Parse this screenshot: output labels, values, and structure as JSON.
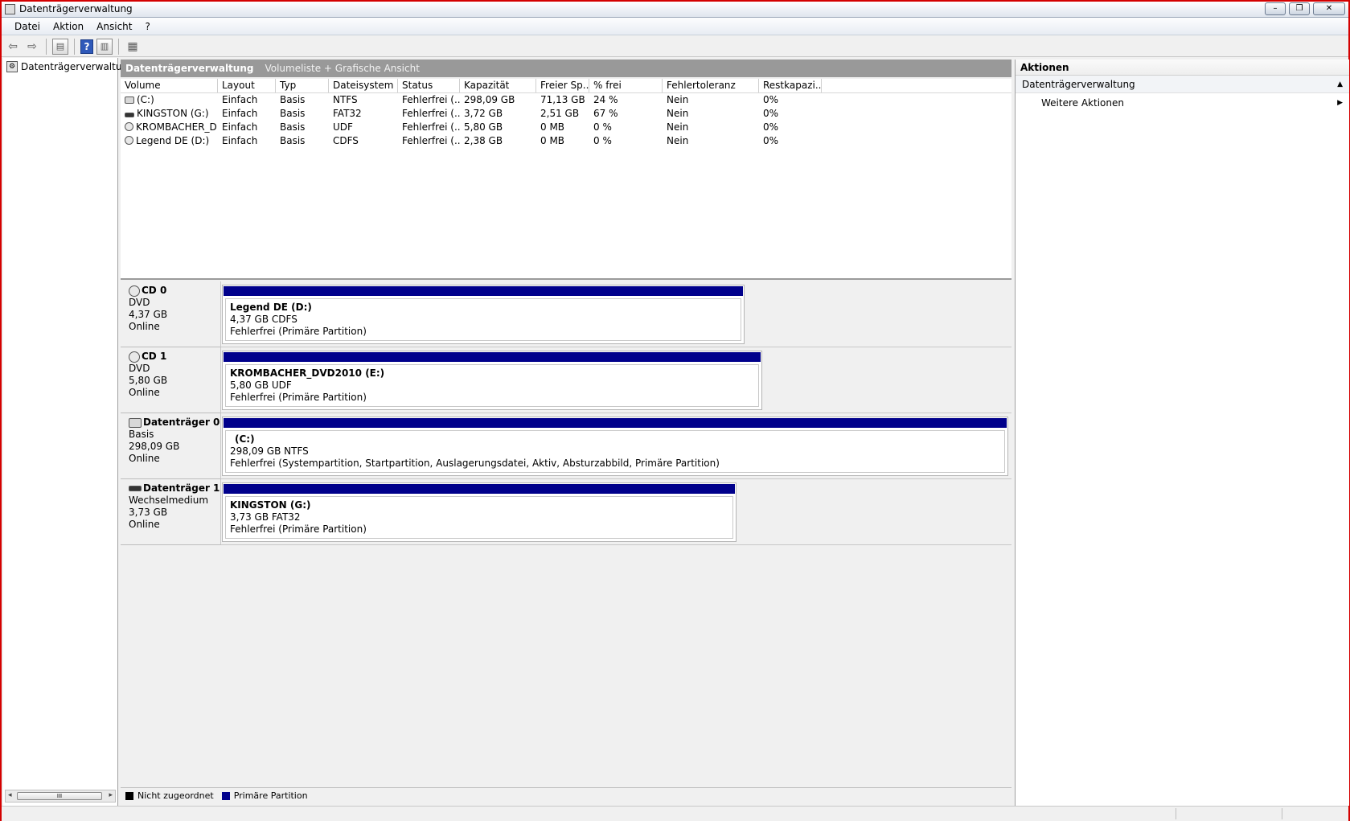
{
  "window": {
    "title": "Datenträgerverwaltung"
  },
  "window_buttons": {
    "minimize": "–",
    "restore": "❐",
    "close": "✕"
  },
  "menu": [
    "Datei",
    "Aktion",
    "Ansicht",
    "?"
  ],
  "toolbar": {
    "back": "⇦",
    "forward": "⇨",
    "help": "?"
  },
  "tree": {
    "item": "Datenträgerverwaltung",
    "scroll_thumb": "III"
  },
  "panel_header": {
    "main": "Datenträgerverwaltung",
    "sub": "Volumeliste + Grafische Ansicht"
  },
  "volume_list": {
    "columns": [
      "Volume",
      "Layout",
      "Typ",
      "Dateisystem",
      "Status",
      "Kapazität",
      "Freier Sp...",
      "% frei",
      "Fehlertoleranz",
      "Restkapazi..."
    ],
    "rows": [
      {
        "icon": "hdd",
        "cells": [
          "(C:)",
          "Einfach",
          "Basis",
          "NTFS",
          "Fehlerfrei (...",
          "298,09 GB",
          "71,13 GB",
          "24 %",
          "Nein",
          "0%"
        ]
      },
      {
        "icon": "usb",
        "cells": [
          "KINGSTON (G:)",
          "Einfach",
          "Basis",
          "FAT32",
          "Fehlerfrei (...",
          "3,72 GB",
          "2,51 GB",
          "67 %",
          "Nein",
          "0%"
        ]
      },
      {
        "icon": "cd",
        "cells": [
          "KROMBACHER_D...",
          "Einfach",
          "Basis",
          "UDF",
          "Fehlerfrei (...",
          "5,80 GB",
          "0 MB",
          "0 %",
          "Nein",
          "0%"
        ]
      },
      {
        "icon": "cd",
        "cells": [
          "Legend DE (D:)",
          "Einfach",
          "Basis",
          "CDFS",
          "Fehlerfrei (...",
          "2,38 GB",
          "0 MB",
          "0 %",
          "Nein",
          "0%"
        ]
      }
    ]
  },
  "disks": [
    {
      "icon": "cd",
      "name": "CD 0",
      "type": "DVD",
      "size": "4,37 GB",
      "state": "Online",
      "partition": {
        "name": "Legend DE  (D:)",
        "info": "4,37 GB CDFS",
        "status": "Fehlerfrei (Primäre Partition)"
      }
    },
    {
      "icon": "cd",
      "name": "CD 1",
      "type": "DVD",
      "size": "5,80 GB",
      "state": "Online",
      "partition": {
        "name": "KROMBACHER_DVD2010  (E:)",
        "info": "5,80 GB UDF",
        "status": "Fehlerfrei (Primäre Partition)"
      }
    },
    {
      "icon": "hdd",
      "name": "Datenträger 0",
      "type": "Basis",
      "size": "298,09 GB",
      "state": "Online",
      "partition": {
        "name": "(C:)",
        "info": "298,09 GB NTFS",
        "status": "Fehlerfrei (Systempartition, Startpartition, Auslagerungsdatei, Aktiv, Absturzabbild, Primäre Partition)"
      }
    },
    {
      "icon": "usb",
      "name": "Datenträger 1",
      "type": "Wechselmedium",
      "size": "3,73 GB",
      "state": "Online",
      "partition": {
        "name": "KINGSTON  (G:)",
        "info": "3,73 GB FAT32",
        "status": "Fehlerfrei (Primäre Partition)"
      }
    }
  ],
  "legend": [
    {
      "label": "Nicht zugeordnet",
      "color": "#000000"
    },
    {
      "label": "Primäre Partition",
      "color": "#00008b"
    }
  ],
  "actions": {
    "title": "Aktionen",
    "section": "Datenträgerverwaltung",
    "item": "Weitere Aktionen"
  },
  "colors": {
    "partition_bar": "#00008b",
    "header_bg": "#999999",
    "frame": "#d40000"
  }
}
